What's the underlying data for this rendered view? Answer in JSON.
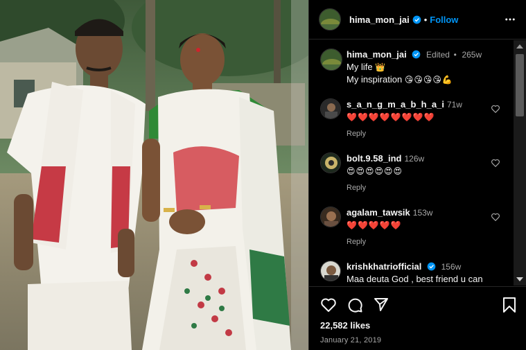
{
  "post": {
    "username": "hima_mon_jai",
    "follow_label": "Follow",
    "dot": "•"
  },
  "caption": {
    "username": "hima_mon_jai",
    "edited": "Edited",
    "dot": "•",
    "time": "265w",
    "line1": "My life",
    "line1_emoji": "👑",
    "line2": "My inspiration",
    "line2_emoji": "😘😘😘😘💪"
  },
  "comments": [
    {
      "username": "s_a_n_g_m_a_b_h_a_i",
      "time": "71w",
      "text": "❤️❤️❤️❤️❤️❤️❤️❤️",
      "reply": "Reply"
    },
    {
      "username": "bolt.9.58_ind",
      "time": "126w",
      "text": "😍😍😍😍😍😍",
      "reply": "Reply"
    },
    {
      "username": "agalam_tawsik",
      "time": "153w",
      "text": "❤️❤️❤️❤️❤️",
      "reply": "Reply"
    },
    {
      "username": "krishkhatriofficial",
      "time": "156w",
      "text": "Maa deuta God , best friend u can"
    }
  ],
  "footer": {
    "likes": "22,582 likes",
    "date": "January 21, 2019"
  },
  "colors": {
    "accent": "#0095f6",
    "background": "#000000",
    "muted": "#a8a8a8"
  }
}
